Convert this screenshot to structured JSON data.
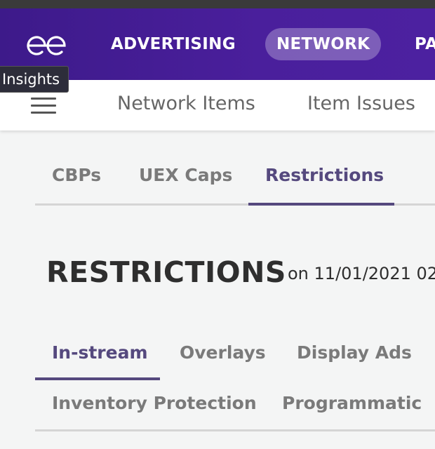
{
  "colors": {
    "brand_purple": "#4a1f9c",
    "active_tab": "#55497e",
    "inactive_tab": "#7a7a7a",
    "page_bg": "#f4f5f5"
  },
  "topnav": {
    "logo_icon": "ee-logo-icon",
    "items": [
      {
        "label": "ADVERTISING",
        "active": false
      },
      {
        "label": "NETWORK",
        "active": true
      },
      {
        "label": "PA",
        "active": false
      }
    ]
  },
  "tooltip": {
    "text": "Insights"
  },
  "subnav": {
    "menu_icon": "hamburger-icon",
    "items": [
      {
        "label": "Network Items"
      },
      {
        "label": "Item Issues"
      }
    ]
  },
  "section_tabs": {
    "items": [
      {
        "label": "CBPs",
        "active": false
      },
      {
        "label": "UEX Caps",
        "active": false
      },
      {
        "label": "Restrictions",
        "active": true
      }
    ]
  },
  "page": {
    "title": "RESTRICTIONS",
    "date": "on 11/01/2021 02"
  },
  "restriction_tabs": {
    "items": [
      {
        "label": "In-stream",
        "active": true
      },
      {
        "label": "Overlays",
        "active": false
      },
      {
        "label": "Display Ads",
        "active": false
      },
      {
        "label": "Inventory Protection",
        "active": false
      },
      {
        "label": "Programmatic",
        "active": false
      }
    ]
  }
}
